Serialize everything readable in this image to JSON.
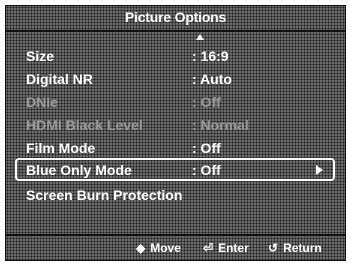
{
  "menu": {
    "title": "Picture Options",
    "items": [
      {
        "label": "Size",
        "value": ": 16:9"
      },
      {
        "label": "Digital NR",
        "value": ": Auto"
      },
      {
        "label": "DNIe",
        "value": ": Off"
      },
      {
        "label": "HDMI Black Level",
        "value": ": Normal"
      },
      {
        "label": "Film Mode",
        "value": ": Off"
      },
      {
        "label": "Blue Only Mode",
        "value": ": Off"
      },
      {
        "label": "Screen Burn Protection",
        "value": ""
      }
    ]
  },
  "footer": {
    "move": {
      "icon": "◆",
      "label": "Move"
    },
    "enter": {
      "icon": "⏎",
      "label": "Enter"
    },
    "return": {
      "icon": "↺",
      "label": "Return"
    }
  }
}
